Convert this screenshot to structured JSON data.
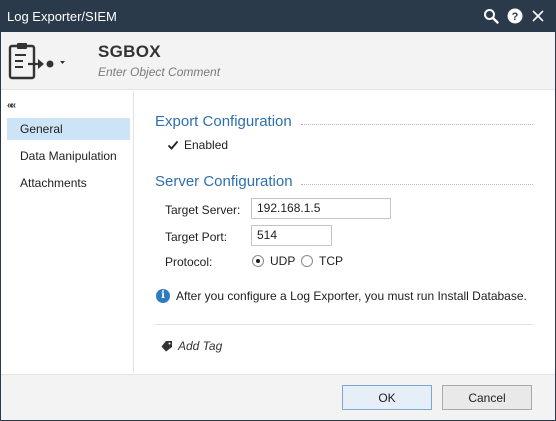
{
  "window": {
    "title": "Log Exporter/SIEM",
    "icons": [
      "search-icon",
      "help-icon",
      "close-icon"
    ]
  },
  "header": {
    "object_name": "SGBOX",
    "comment_placeholder": "Enter Object Comment",
    "object_icon": "log-exporter-icon"
  },
  "sidebar": {
    "collapse_glyph": "««",
    "items": [
      {
        "label": "General",
        "active": true
      },
      {
        "label": "Data Manipulation",
        "active": false
      },
      {
        "label": "Attachments",
        "active": false
      }
    ]
  },
  "export_configuration": {
    "title": "Export Configuration",
    "enabled_label": "Enabled",
    "enabled": true
  },
  "server_configuration": {
    "title": "Server Configuration",
    "target_server_label": "Target Server:",
    "target_server_value": "192.168.1.5",
    "target_port_label": "Target Port:",
    "target_port_value": "514",
    "protocol_label": "Protocol:",
    "protocol_options": [
      "UDP",
      "TCP"
    ],
    "protocol_selected": "UDP"
  },
  "info": {
    "glyph": "i",
    "text": "After you configure a Log Exporter, you must run Install Database."
  },
  "tags": {
    "add_tag_label": "Add Tag"
  },
  "footer": {
    "ok_label": "OK",
    "cancel_label": "Cancel"
  },
  "colors": {
    "titlebar": "#2b3a4a",
    "section_title": "#2e6fae",
    "nav_active": "#cde4f7",
    "info_icon": "#2e7bc4"
  }
}
